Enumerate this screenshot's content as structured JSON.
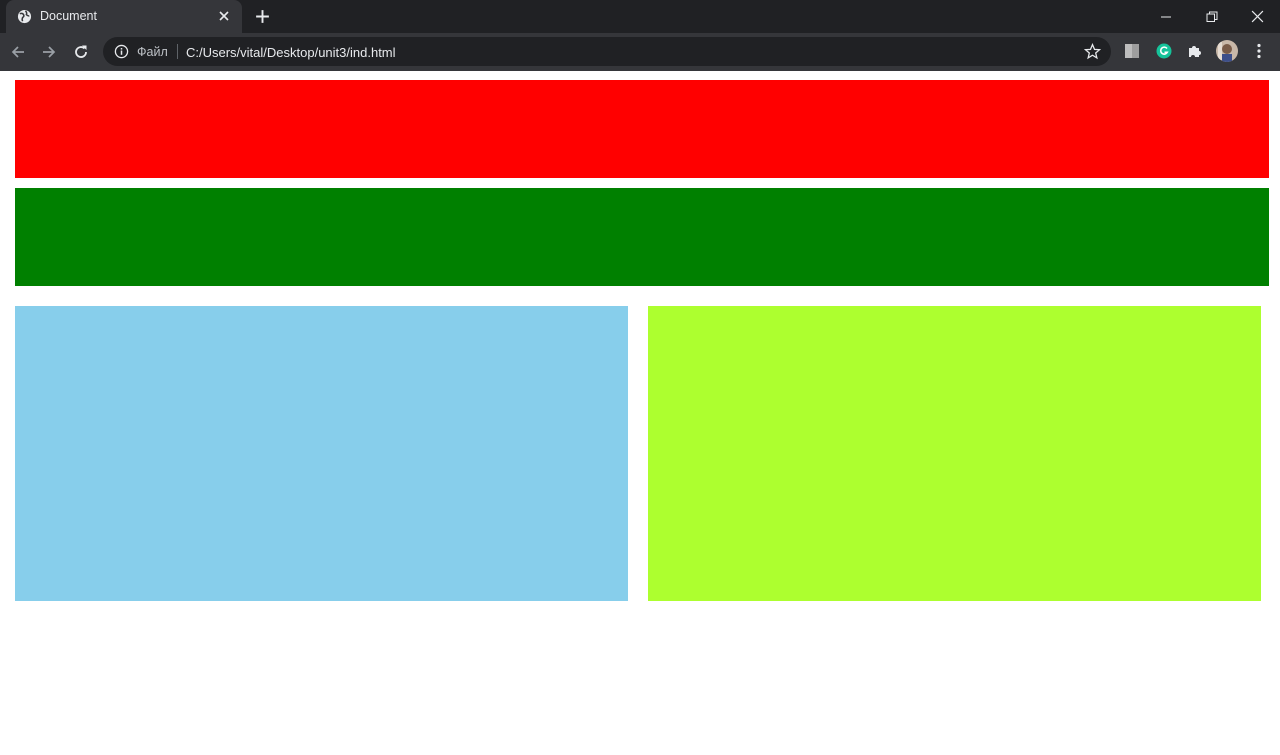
{
  "browser": {
    "tab": {
      "title": "Document",
      "favicon": "globe-icon"
    },
    "toolbar": {
      "scheme_label": "Файл",
      "url": "C:/Users/vital/Desktop/unit3/ind.html"
    },
    "colors": {
      "tabbar": "#202124",
      "toolbar": "#35363a",
      "omnibox": "#202124"
    }
  },
  "page": {
    "blocks": [
      {
        "name": "red-block",
        "color": "#ff0000"
      },
      {
        "name": "green-block",
        "color": "#008000"
      },
      {
        "name": "skyblue-block",
        "color": "#87ceeb"
      },
      {
        "name": "greenyellow-block",
        "color": "#adff2f"
      }
    ]
  }
}
